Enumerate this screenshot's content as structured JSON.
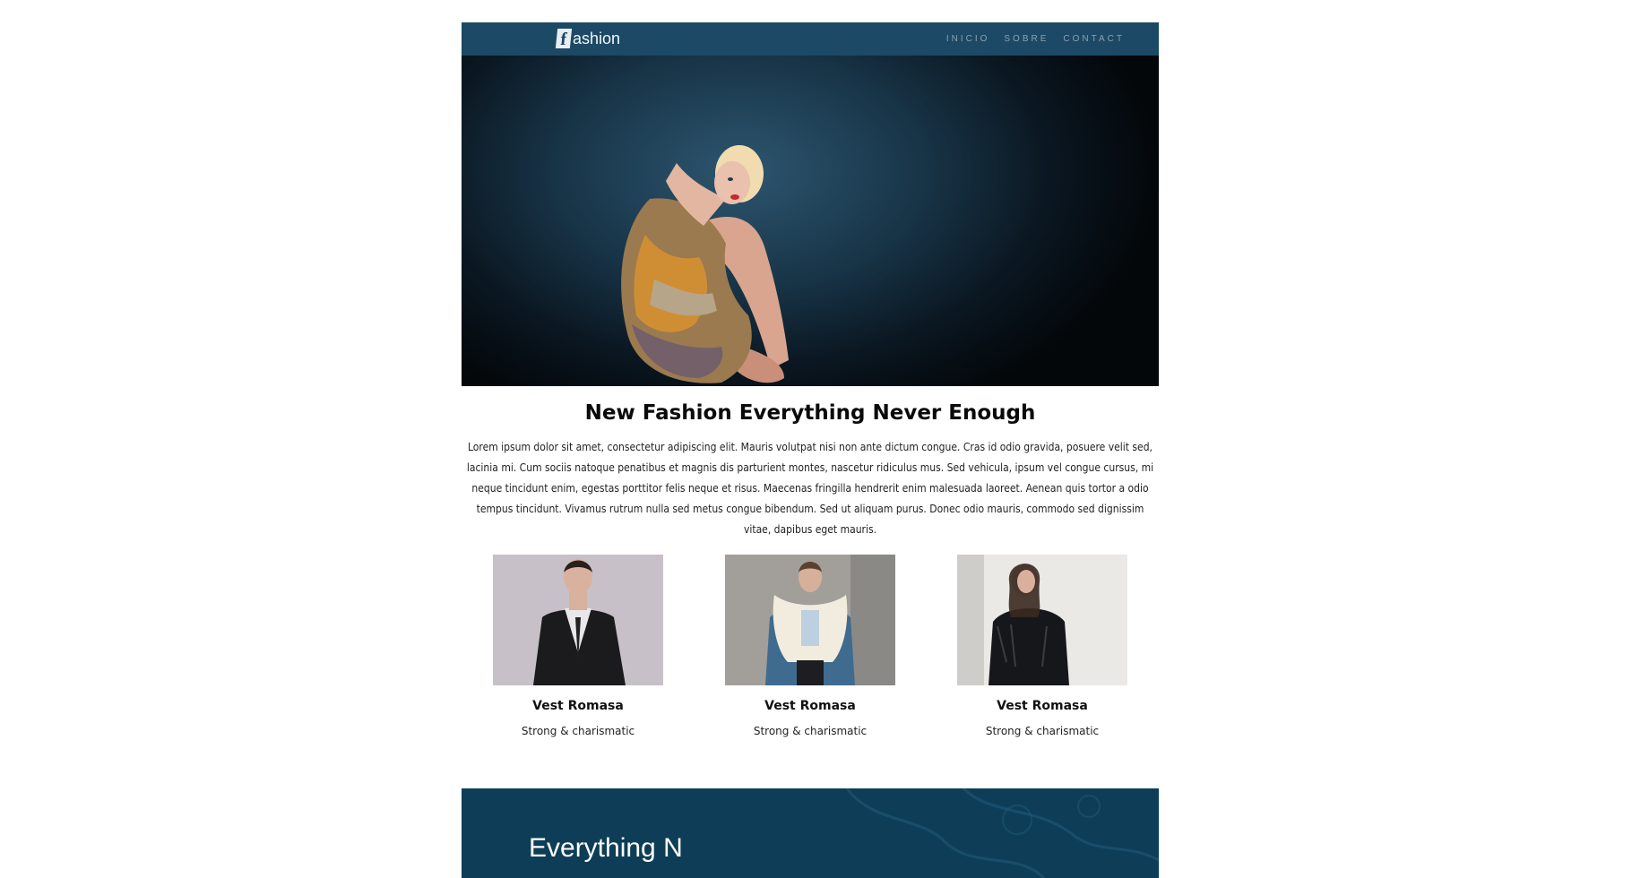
{
  "header": {
    "logo_letter": "f",
    "logo_text": "ashion",
    "nav": [
      "INICIO",
      "SOBRE",
      "CONTACT"
    ]
  },
  "main": {
    "headline": "New Fashion Everything Never Enough",
    "intro": "Lorem ipsum dolor sit amet, consectetur adipiscing elit. Mauris volutpat nisi non ante dictum congue. Cras id odio gravida, posuere velit sed, lacinia mi. Cum sociis natoque penatibus et magnis dis parturient montes, nascetur ridiculus mus. Sed vehicula, ipsum vel congue cursus, mi neque tincidunt enim, egestas porttitor felis neque et risus. Maecenas fringilla hendrerit enim malesuada laoreet. Aenean quis tortor a odio tempus tincidunt. Vivamus rutrum nulla sed metus congue bibendum. Sed ut aliquam purus. Donec odio mauris, commodo sed dignissim vitae, dapibus eget mauris.",
    "products": [
      {
        "name": "Vest Romasa",
        "desc": "Strong & charismatic"
      },
      {
        "name": "Vest Romasa",
        "desc": "Strong & charismatic"
      },
      {
        "name": "Vest Romasa",
        "desc": "Strong & charismatic"
      }
    ]
  },
  "footer": {
    "title": "Everything N"
  },
  "colors": {
    "header_bg": "#1c4965",
    "footer_bg": "#0e3e57"
  }
}
